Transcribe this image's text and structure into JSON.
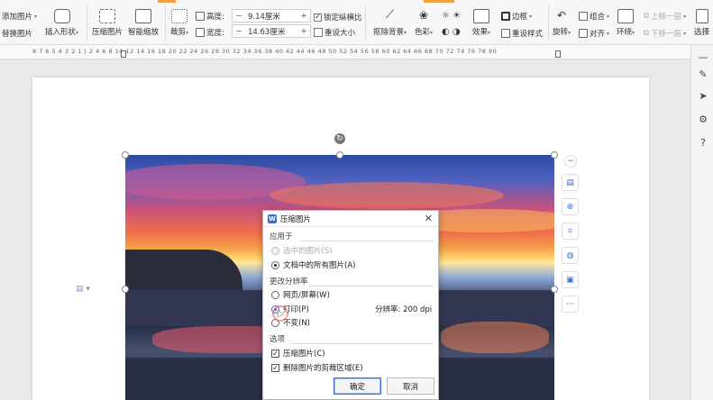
{
  "toolbar": {
    "add_image": "添加图片",
    "replace_image": "替换图片",
    "insert_shape": "插入形状",
    "compress_image": "压缩图片",
    "smart_scale": "智能缩放",
    "crop": "裁剪",
    "height_label": "高度:",
    "height_value": "9.14厘米",
    "width_label": "宽度:",
    "width_value": "14.63厘米",
    "lock_ratio": "锁定纵横比",
    "reset_size": "重设大小",
    "remove_bg": "抠除背景",
    "color": "色彩",
    "effects": "效果",
    "reset_style": "重设样式",
    "border": "边框",
    "rotate": "旋转",
    "combine": "组合",
    "align": "对齐",
    "wrap": "环绕",
    "bring_forward": "上移一层",
    "send_backward": "下移一层",
    "select": "选择"
  },
  "ruler": {
    "numbers": "8  7  6  5  4  3  2  1  |  2  4  6  8  10  12  14  16  18  20  22  24  26  28  30  32  34  36  38  40  42  44  46  48  50  52  54  56  58  60  62  64  66  68  70  72  74  76  78  80"
  },
  "dialog": {
    "title": "压缩图片",
    "apply_section": "应用于",
    "opt_selected": "选中的图片(S)",
    "opt_all": "文档中的所有图片(A)",
    "resolution_section": "更改分辨率",
    "opt_web": "网页/屏幕(W)",
    "opt_print": "打印(P)",
    "opt_nochange": "不变(N)",
    "resolution_text": "分辨率: 200 dpi",
    "options_section": "选项",
    "chk_compress": "压缩图片(C)",
    "chk_delete_crop": "删除图片的剪裁区域(E)",
    "ok": "确定",
    "cancel": "取消"
  },
  "colors": {
    "accent": "#2f6fe0",
    "tab_highlight": "#f0a040"
  }
}
